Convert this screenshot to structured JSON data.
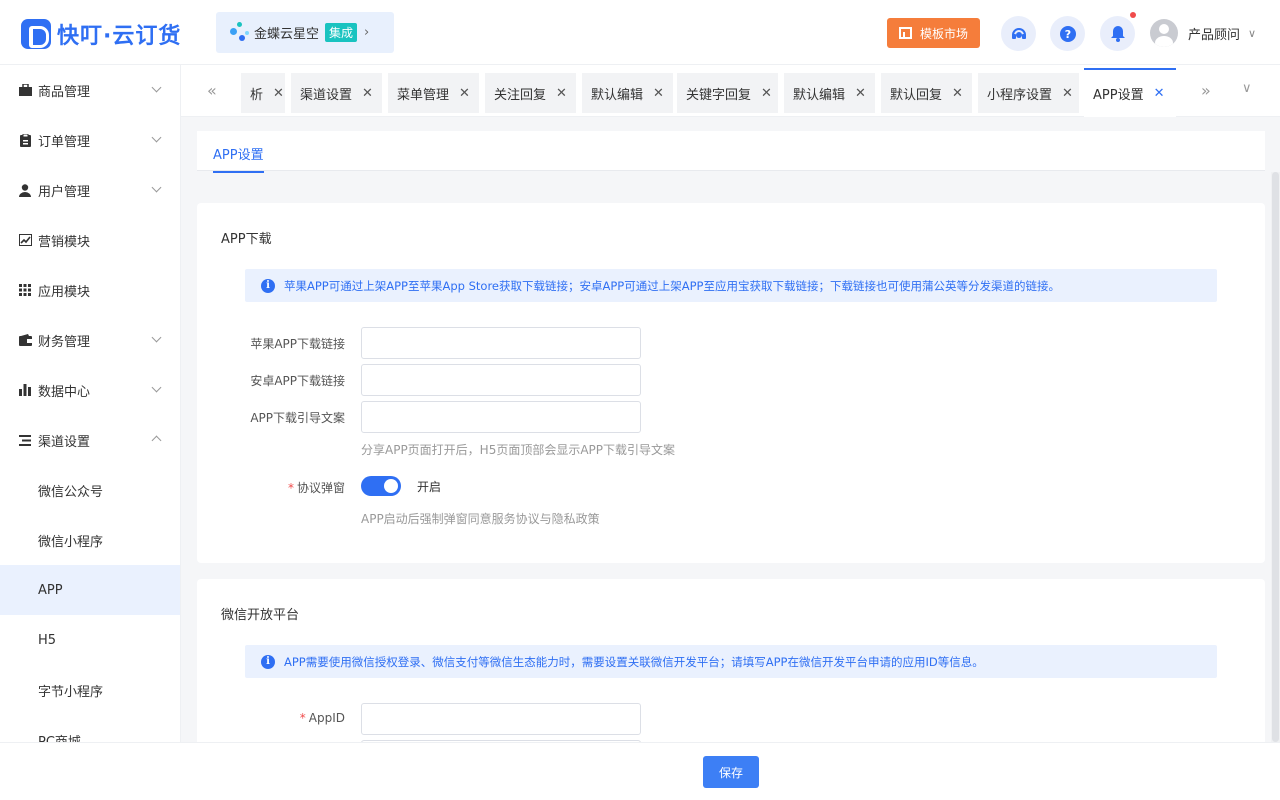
{
  "brand": {
    "name": "快叮·云订货"
  },
  "integration": {
    "label": "金蝶云星空",
    "tag": "集成"
  },
  "header": {
    "market_label": "模板市场",
    "user_name": "产品顾问"
  },
  "sidebar": {
    "items": [
      {
        "label": "商品管理",
        "icon": "box-icon"
      },
      {
        "label": "订单管理",
        "icon": "clipboard-icon"
      },
      {
        "label": "用户管理",
        "icon": "user-icon"
      },
      {
        "label": "营销模块",
        "icon": "chart-line-icon"
      },
      {
        "label": "应用模块",
        "icon": "grid-icon"
      },
      {
        "label": "财务管理",
        "icon": "wallet-icon"
      },
      {
        "label": "数据中心",
        "icon": "bar-chart-icon"
      },
      {
        "label": "渠道设置",
        "icon": "list-icon"
      }
    ],
    "subitems": [
      "微信公众号",
      "微信小程序",
      "APP",
      "H5",
      "字节小程序",
      "PC商城"
    ]
  },
  "tabs": [
    "析",
    "渠道设置",
    "菜单管理",
    "关注回复",
    "默认编辑",
    "关键字回复",
    "默认编辑",
    "默认回复",
    "小程序设置",
    "APP设置"
  ],
  "page": {
    "subtab": "APP设置",
    "download": {
      "title": "APP下载",
      "alert": "苹果APP可通过上架APP至苹果App Store获取下载链接；安卓APP可通过上架APP至应用宝获取下载链接；下载链接也可使用蒲公英等分发渠道的链接。",
      "ios_label": "苹果APP下载链接",
      "android_label": "安卓APP下载链接",
      "guide_label": "APP下载引导文案",
      "guide_hint": "分享APP页面打开后，H5页面顶部会显示APP下载引导文案",
      "protocol_label": "协议弹窗",
      "protocol_state": "开启",
      "protocol_hint": "APP启动后强制弹窗同意服务协议与隐私政策"
    },
    "wechat": {
      "title": "微信开放平台",
      "alert": "APP需要使用微信授权登录、微信支付等微信生态能力时，需要设置关联微信开发平台；请填写APP在微信开发平台申请的应用ID等信息。",
      "appid_label": "AppID"
    }
  },
  "footer": {
    "save_label": "保存"
  },
  "colors": {
    "primary": "#2f6ff3",
    "market": "#f57d3b",
    "tag": "#19c3c0"
  }
}
